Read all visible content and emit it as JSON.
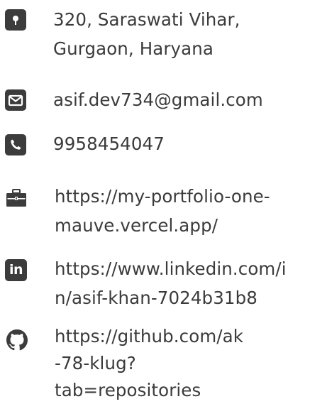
{
  "contact": {
    "address": {
      "icon": "location-pin-icon",
      "line1": "320, Saraswati Vihar,",
      "line2": "Gurgaon, Haryana"
    },
    "email": {
      "icon": "envelope-icon",
      "value": "asif.dev734@gmail.com"
    },
    "phone": {
      "icon": "phone-icon",
      "value": "9958454047"
    },
    "portfolio": {
      "icon": "briefcase-icon",
      "line1": "https://my-portfolio-one-",
      "line2": "mauve.vercel.app/"
    },
    "linkedin": {
      "icon": "linkedin-icon",
      "badge": "in",
      "line1": "https://www.linkedin.com/i",
      "line2": "n/asif-khan-7024b31b8"
    },
    "github": {
      "icon": "github-icon",
      "line1": "https://github.com/ak",
      "line2": "-78-klug?",
      "line3": "tab=repositories"
    }
  },
  "colors": {
    "icon": "#3c3c3c",
    "text": "#3b3b3b",
    "background": "#ffffff"
  }
}
